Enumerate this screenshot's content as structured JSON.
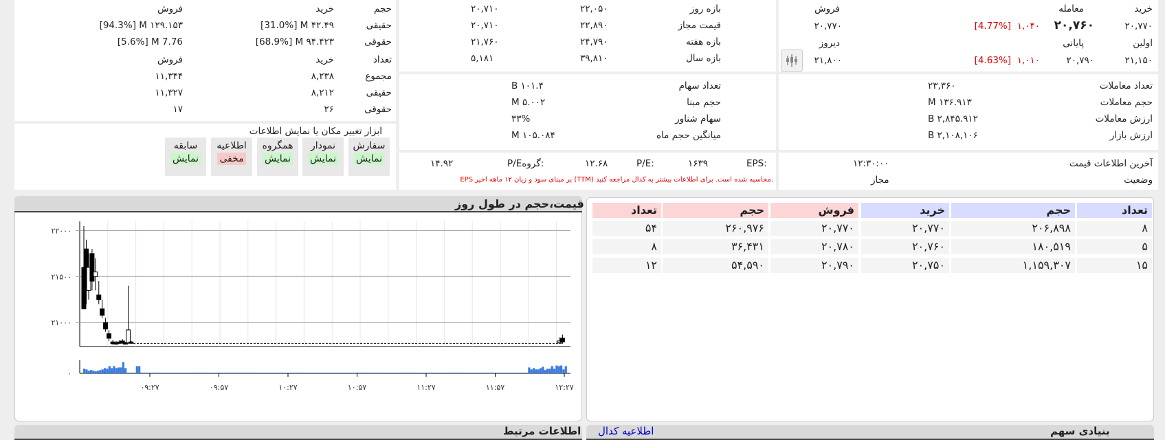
{
  "instrument": {
    "trade_label": "خرید",
    "trade_value": "۲۰,۷۷۰",
    "last_trade_label": "معامله",
    "last_trade_value": "۲۰,۷۶۰",
    "last_trade_change": "۱,۰۴۰",
    "last_trade_pct": "[4.77%]",
    "sell_label": "فروش",
    "sell_value": "۲۰,۷۷۰",
    "first_label": "اولین",
    "first_value": "۲۱,۱۵۰",
    "final_label": "پایانی",
    "final_value": "۲۰,۷۹۰",
    "final_change": "۱,۰۱۰",
    "final_pct": "[4.63%]",
    "yesterday_label": "دیروز",
    "yesterday_value": "۲۱,۸۰۰"
  },
  "ranges": [
    {
      "label": "بازه روز",
      "v1": "۲۲,۰۵۰",
      "v2": "۲۰,۷۱۰"
    },
    {
      "label": "قیمت مجاز",
      "v1": "۲۲,۸۹۰",
      "v2": "۲۰,۷۱۰"
    },
    {
      "label": "بازه هفته",
      "v1": "۲۴,۷۹۰",
      "v2": "۲۱,۷۶۰"
    },
    {
      "label": "بازه سال",
      "v1": "۳۹,۸۱۰",
      "v2": "۵,۱۸۱"
    }
  ],
  "volume_box": {
    "header": {
      "label": "حجم",
      "buy": "خرید",
      "sell": "فروش"
    },
    "rows": [
      {
        "label": "حقیقی",
        "buy": "[31.0%] M ۴۲.۴۹",
        "sell": "[94.3%] M ۱۲۹.۱۵۳"
      },
      {
        "label": "حقوقی",
        "buy": "[68.9%] M ۹۴.۴۲۳",
        "sell": "[5.6%] M 7.76"
      }
    ],
    "count_header": {
      "label": "تعداد",
      "buy": "خرید",
      "sell": "فروش"
    },
    "count_rows": [
      {
        "label": "مجموع",
        "buy": "۸,۲۳۸",
        "sell": "۱۱,۳۴۴"
      },
      {
        "label": "حقیقی",
        "buy": "۸,۲۱۲",
        "sell": "۱۱,۳۲۷"
      },
      {
        "label": "حقوقی",
        "buy": "۲۶",
        "sell": "۱۷"
      }
    ]
  },
  "trading_stats": [
    {
      "label": "تعداد معاملات",
      "value": "۲۳,۳۶۰"
    },
    {
      "label": "حجم معاملات",
      "value": "M ۱۳۶.۹۱۳"
    },
    {
      "label": "ارزش معاملات",
      "value": "B ۲,۸۴۵.۹۱۲"
    },
    {
      "label": "ارزش بازار",
      "value": "B ۲,۱۰۸,۱۰۶"
    }
  ],
  "share_stats": [
    {
      "label": "تعداد سهام",
      "value": "B ۱۰۱.۴"
    },
    {
      "label": "حجم مبنا",
      "value": "M ۵.۰۰۲"
    },
    {
      "label": "سهام شناور",
      "value": "۳۳%"
    },
    {
      "label": "میانگین حجم ماه",
      "value": "M ۱۰۵.۰۸۴"
    }
  ],
  "tools": {
    "title": "ابزار تغییر مکان یا نمایش اطلاعات",
    "items": [
      {
        "name": "سفارش",
        "state": "نمایش",
        "on": true
      },
      {
        "name": "نمودار",
        "state": "نمایش",
        "on": true
      },
      {
        "name": "همگروه",
        "state": "نمایش",
        "on": true
      },
      {
        "name": "اطلاعیه",
        "state": "مخفی",
        "on": false
      },
      {
        "name": "سابقه",
        "state": "نمایش",
        "on": true
      }
    ]
  },
  "ratios": {
    "eps_label": "EPS:",
    "eps_value": "۱۶۳۹",
    "pe_label": "P/E:",
    "pe_value": "۱۲.۶۸",
    "group_pe_label": "P/Eگروه:",
    "group_pe_value": "۱۴.۹۲",
    "eps_note": "EPS بر مبنای سود و زیان ۱۲ ماهه اخیر (TTM) محاسبه شده است. برای اطلاعات بیشتر به کدال مراجعه کنید."
  },
  "status": {
    "last_update_label": "آخرین اطلاعات قیمت",
    "last_update_value": "۱۲:۳۰:۰۰",
    "status_label": "وضعیت",
    "status_value": "مجاز"
  },
  "orderbook": {
    "headers": [
      "تعداد",
      "حجم",
      "خرید",
      "فروش",
      "حجم",
      "تعداد"
    ],
    "rows": [
      [
        "۸",
        "۲۰۶,۸۹۸",
        "۲۰,۷۷۰",
        "۲۰,۷۷۰",
        "۲۶۰,۹۷۶",
        "۵۴"
      ],
      [
        "۵",
        "۱۸۰,۵۱۹",
        "۲۰,۷۶۰",
        "۲۰,۷۸۰",
        "۳۶,۴۳۱",
        "۸"
      ],
      [
        "۱۵",
        "۱,۱۵۹,۳۰۷",
        "۲۰,۷۵۰",
        "۲۰,۷۹۰",
        "۵۴,۵۹۰",
        "۱۲"
      ]
    ]
  },
  "chart_panel": {
    "title": "قیمت،حجم در طول روز"
  },
  "chart_data": {
    "type": "bar",
    "title": "قیمت،حجم در طول روز",
    "ylim": [
      20740,
      22100
    ],
    "y_ticks": [
      {
        "value": 21000,
        "label": "۲۱۰۰۰"
      },
      {
        "value": 21500,
        "label": "۲۱۵۰۰"
      },
      {
        "value": 22000,
        "label": "۲۲۰۰۰"
      }
    ],
    "volume_zero_label": "۰",
    "x_ticks": [
      "۰۹:۲۷",
      "۰۹:۵۷",
      "۱۰:۲۷",
      "۱۰:۵۷",
      "۱۱:۲۷",
      "۱۱:۵۷",
      "۱۲:۲۷"
    ],
    "candles": [
      {
        "o": 21150,
        "h": 22050,
        "l": 21150,
        "c": 21600,
        "up": false
      },
      {
        "o": 21400,
        "h": 21900,
        "l": 21200,
        "c": 21800,
        "up": false
      },
      {
        "o": 21350,
        "h": 21750,
        "l": 21250,
        "c": 21600,
        "up": true
      },
      {
        "o": 21750,
        "h": 21800,
        "l": 21350,
        "c": 21450,
        "up": false
      },
      {
        "o": 21550,
        "h": 21700,
        "l": 21350,
        "c": 21500,
        "up": true
      },
      {
        "o": 21300,
        "h": 21450,
        "l": 21200,
        "c": 21250,
        "up": false
      },
      {
        "o": 21150,
        "h": 21250,
        "l": 21050,
        "c": 21080,
        "up": false
      },
      {
        "o": 21000,
        "h": 21050,
        "l": 20900,
        "c": 20930,
        "up": false
      },
      {
        "o": 20880,
        "h": 20920,
        "l": 20800,
        "c": 20830,
        "up": false
      },
      {
        "o": 20790,
        "h": 20810,
        "l": 20760,
        "c": 20770,
        "up": false
      },
      {
        "o": 20780,
        "h": 20800,
        "l": 20760,
        "c": 20770,
        "up": false
      },
      {
        "o": 20790,
        "h": 20810,
        "l": 20770,
        "c": 20780,
        "up": false
      },
      {
        "o": 20800,
        "h": 20820,
        "l": 20770,
        "c": 20790,
        "up": false
      },
      {
        "o": 20780,
        "h": 20790,
        "l": 20770,
        "c": 20775,
        "up": false
      },
      {
        "o": 20780,
        "h": 21400,
        "l": 20770,
        "c": 20920,
        "up": true
      },
      {
        "o": 20780,
        "h": 20800,
        "l": 20770,
        "c": 20790,
        "up": false
      },
      {
        "o": 20780,
        "h": 20840,
        "l": 20770,
        "c": 20800,
        "up": true
      },
      {
        "o": 20790,
        "h": 20870,
        "l": 20770,
        "c": 20830,
        "up": false
      }
    ],
    "candle_times": [
      0.0,
      0.005,
      0.01,
      0.017,
      0.024,
      0.031,
      0.038,
      0.045,
      0.052,
      0.06,
      0.067,
      0.074,
      0.08,
      0.086,
      0.092,
      0.098,
      0.985,
      0.992
    ],
    "flat_line_value": 20775,
    "volumes": [
      0.35,
      0.3,
      0.2,
      0.25,
      0.2,
      0.15,
      0.2,
      0.25,
      0.3,
      0.4,
      0.35,
      0.55,
      0.4,
      0.55,
      0.4,
      0.45,
      0.45,
      0.85,
      0.4,
      0.05,
      0.05,
      0.05,
      0.05,
      0.55,
      0.55,
      0.05,
      0.05,
      0.05,
      0.05,
      0.05,
      0.05,
      0.05,
      0.05,
      0.05,
      0.05,
      0.05,
      0.05,
      0.05,
      0.05,
      0.05,
      0.05,
      0.05,
      0.05,
      0.05,
      0.05,
      0.05,
      0.05,
      0.05,
      0.05,
      0.05,
      0.05,
      0.05,
      0.05,
      0.05,
      0.05,
      0.05,
      0.05,
      0.05,
      0.05,
      0.05,
      0.05,
      0.05,
      0.05,
      0.05,
      0.05,
      0.05,
      0.05,
      0.05,
      0.05,
      0.05,
      0.05,
      0.05,
      0.05,
      0.05,
      0.05,
      0.05,
      0.05,
      0.05,
      0.05,
      0.05,
      0.05,
      0.05,
      0.05,
      0.05,
      0.05,
      0.05,
      0.05,
      0.05,
      0.05,
      0.05,
      0.05,
      0.05,
      0.05,
      0.05,
      0.05,
      0.05,
      0.05,
      0.05,
      0.05,
      0.05,
      0.05,
      0.05,
      0.05,
      0.05,
      0.05,
      0.05,
      0.05,
      0.05,
      0.05,
      0.05,
      0.05,
      0.05,
      0.05,
      0.05,
      0.05,
      0.05,
      0.05,
      0.05,
      0.05,
      0.05,
      0.05,
      0.05,
      0.05,
      0.05,
      0.05,
      0.05,
      0.05,
      0.05,
      0.05,
      0.05,
      0.05,
      0.05,
      0.05,
      0.05,
      0.05,
      0.05,
      0.05,
      0.05,
      0.05,
      0.05,
      0.05,
      0.05,
      0.05,
      0.05,
      0.05,
      0.05,
      0.05,
      0.05,
      0.05,
      0.05,
      0.05,
      0.05,
      0.05,
      0.05,
      0.05,
      0.05,
      0.05,
      0.05,
      0.05,
      0.05,
      0.05,
      0.05,
      0.05,
      0.05,
      0.05,
      0.05,
      0.05,
      0.05,
      0.05,
      0.05,
      0.05,
      0.05,
      0.05,
      0.05,
      0.05,
      0.05,
      0.05,
      0.05,
      0.05,
      0.05,
      0.05,
      0.05,
      0.05,
      0.05,
      0.05,
      0.05,
      0.05,
      0.05,
      0.05,
      0.05,
      0.05,
      0.05,
      0.05,
      0.05,
      0.45,
      0.3,
      0.4,
      0.3,
      0.3,
      0.4,
      0.5,
      0.25,
      0.35,
      0.35,
      0.55,
      0.35,
      0.6,
      0.55,
      0.6,
      0.3,
      0.55
    ],
    "grid": true
  },
  "bottom": {
    "left_title": "اطلاعات مرتبط",
    "left_link": "...",
    "right_link": "اطلاعیه کدال",
    "right_title": "بنیادی سهم"
  }
}
